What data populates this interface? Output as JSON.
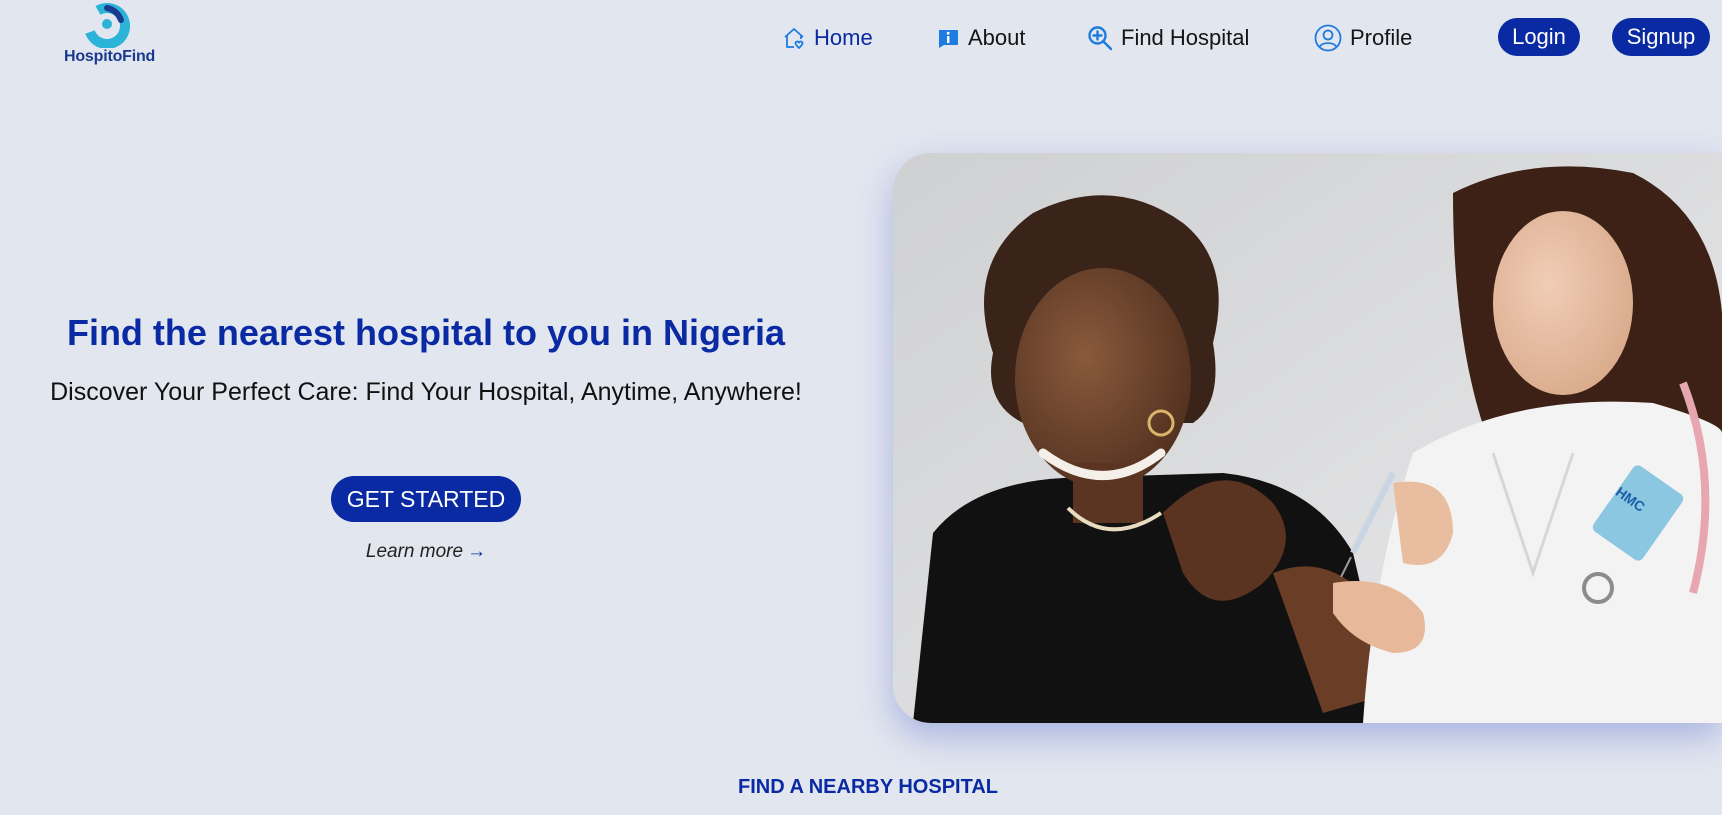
{
  "brand": {
    "name": "HospitoFind",
    "primary_color": "#0a2aa3",
    "logo_color": "#2bb3d8"
  },
  "nav": {
    "items": [
      {
        "label": "Home",
        "icon": "home-icon",
        "active": true
      },
      {
        "label": "About",
        "icon": "info-icon",
        "active": false
      },
      {
        "label": "Find Hospital",
        "icon": "search-plus-icon",
        "active": false
      },
      {
        "label": "Profile",
        "icon": "user-circle-icon",
        "active": false
      }
    ],
    "login_label": "Login",
    "signup_label": "Signup"
  },
  "hero": {
    "title": "Find the nearest hospital to you in Nigeria",
    "subtitle": "Discover Your Perfect Care: Find Your Hospital, Anytime, Anywhere!",
    "cta_label": "GET STARTED",
    "learn_more_label": "Learn more",
    "learn_more_arrow": "→",
    "badge_text": "HMC"
  },
  "section": {
    "title": "FIND A NEARBY HOSPITAL"
  }
}
